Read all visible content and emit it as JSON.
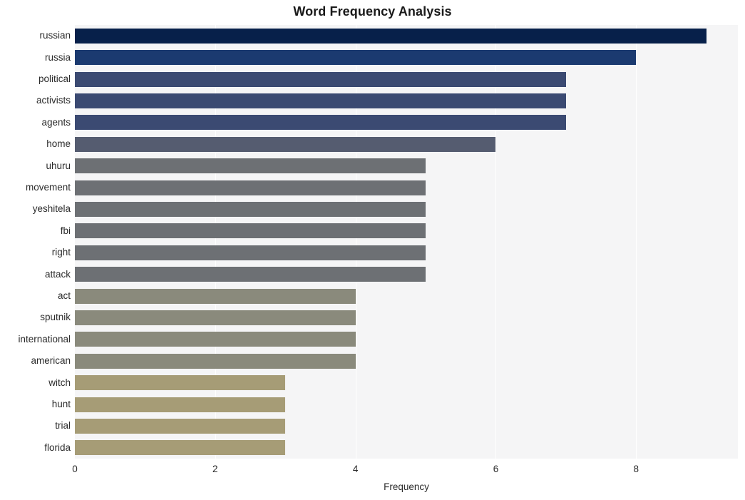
{
  "chart_data": {
    "type": "bar",
    "orientation": "horizontal",
    "title": "Word Frequency Analysis",
    "xlabel": "Frequency",
    "ylabel": "",
    "categories": [
      "russian",
      "russia",
      "political",
      "activists",
      "agents",
      "home",
      "uhuru",
      "movement",
      "yeshitela",
      "fbi",
      "right",
      "attack",
      "act",
      "sputnik",
      "international",
      "american",
      "witch",
      "hunt",
      "trial",
      "florida"
    ],
    "values": [
      9,
      8,
      7,
      7,
      7,
      6,
      5,
      5,
      5,
      5,
      5,
      5,
      4,
      4,
      4,
      4,
      3,
      3,
      3,
      3
    ],
    "bar_colors": [
      "#07204a",
      "#1b3a70",
      "#3b4a72",
      "#3b4a72",
      "#3b4a72",
      "#555c70",
      "#6d7074",
      "#6d7074",
      "#6d7074",
      "#6d7074",
      "#6d7074",
      "#6d7074",
      "#8a8a7c",
      "#8a8a7c",
      "#8a8a7c",
      "#8a8a7c",
      "#a69c76",
      "#a69c76",
      "#a69c76",
      "#a69c76"
    ],
    "xlim": [
      0,
      9.45
    ],
    "xticks": [
      0,
      2,
      4,
      6,
      8
    ],
    "xtick_labels": [
      "0",
      "2",
      "4",
      "6",
      "8"
    ],
    "gridlines_x": [
      2,
      4,
      6,
      8
    ],
    "grid": true,
    "grid_color": "#ffffff",
    "legend": null,
    "plot_background": "#f5f5f6",
    "figure_background": "#ffffff",
    "title_color": "#1a1a1a",
    "tick_color": "#2b2b2b"
  }
}
